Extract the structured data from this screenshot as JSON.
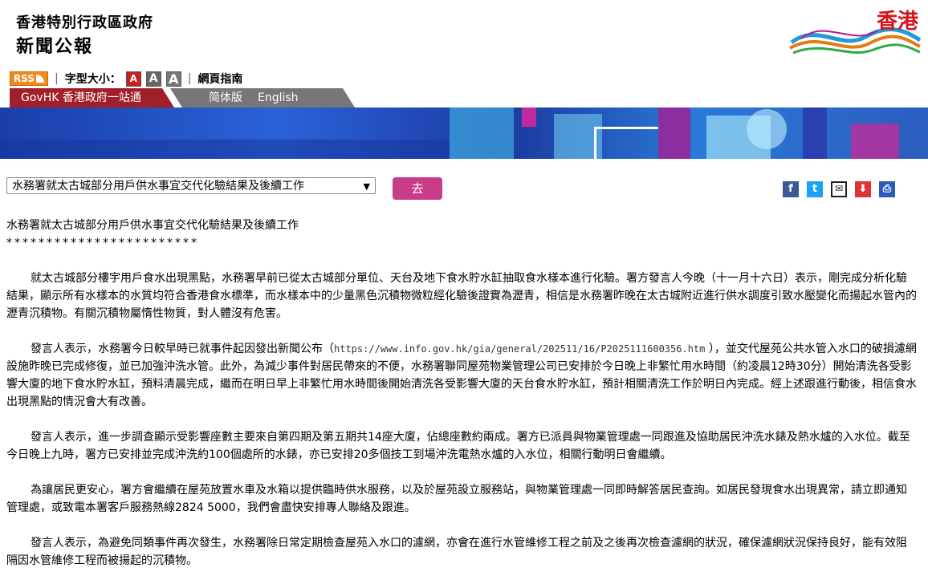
{
  "header": {
    "org": "香港特別行政區政府",
    "title": "新聞公報",
    "logo_text": "香港"
  },
  "toolbar": {
    "rss": "RSS",
    "font_size_label": "字型大小：",
    "font_small": "A",
    "font_medium": "A",
    "font_large": "A",
    "web_guide": "網頁指南"
  },
  "tabs": {
    "govhk": "GovHK 香港政府一站通",
    "simplified": "简体版",
    "english": "English"
  },
  "nav": {
    "selected": "水務署就太古城部分用戶供水事宜交代化驗結果及後續工作",
    "go": "去"
  },
  "share_icons": [
    "facebook-icon",
    "twitter-icon",
    "email-icon",
    "bookmark-icon",
    "print-icon"
  ],
  "article": {
    "title": "水務署就太古城部分用戶供水事宜交代化驗結果及後續工作",
    "stars": "************************",
    "p1": "就太古城部分樓宇用戶食水出現黑點，水務署早前已從太古城部分單位、天台及地下食水貯水缸抽取食水樣本進行化驗。署方發言人今晚（十一月十六日）表示，剛完成分析化驗結果，顯示所有水樣本的水質均符合香港食水標準，而水樣本中的少量黑色沉積物微粒經化驗後證實為瀝青，相信是水務署昨晚在太古城附近進行供水調度引致水壓變化而揚起水管內的瀝青沉積物。有關沉積物屬惰性物質，對人體沒有危害。",
    "p2_before": "發言人表示，水務署今日較早時已就事件起因發出新聞公布（",
    "p2_link": "https://www.info.gov.hk/gia/general/202511/16/P2025111600356.htm",
    "p2_after": " ），並交代屋苑公共水管入水口的破損濾網設施昨晚已完成修復，並已加強沖洗水管。此外，為減少事件對居民帶來的不便，水務署聯同屋苑物業管理公司已安排於今日晚上非繁忙用水時間（約凌晨12時30分）開始清洗各受影響大廈的地下食水貯水缸，預料清晨完成，繼而在明日早上非繁忙用水時間後開始清洗各受影響大廈的天台食水貯水缸，預計相關清洗工作於明日內完成。經上述跟進行動後，相信食水出現黑點的情況會大有改善。",
    "p3": "發言人表示，進一步調查顯示受影響座數主要來自第四期及第五期共14座大廈，佔總座數約兩成。署方已派員與物業管理處一同跟進及協助居民沖洗水錶及熱水爐的入水位。截至今日晚上九時，署方已安排並完成沖洗約100個處所的水錶，亦已安排20多個技工到場沖洗電熱水爐的入水位，相關行動明日會繼續。",
    "p4": "為讓居民更安心，署方會繼續在屋苑放置水車及水箱以提供臨時供水服務，以及於屋苑設立服務站，與物業管理處一同即時解答居民查詢。如居民發現食水出現異常，請立即通知管理處，或致電本署客戶服務熱線2824 5000，我們會盡快安排專人聯絡及跟進。",
    "p5": "發言人表示，為避免同類事件再次發生，水務署除日常定期檢查屋苑入水口的濾網，亦會在進行水管維修工程之前及之後再次檢查濾網的狀況，確保濾網狀況保持良好，能有效阻隔因水管維修工程而被揚起的沉積物。"
  },
  "colors": {
    "govhk_tab": "#a0202a",
    "go_button": "#c83c8a",
    "rss": "#f18a1c"
  }
}
